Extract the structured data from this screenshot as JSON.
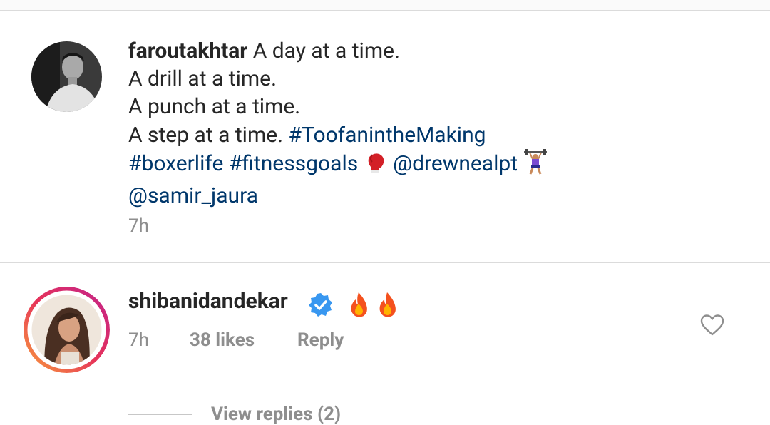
{
  "caption": {
    "username": "faroutakhtar",
    "line1_text": " A day at a time.",
    "line2_text": "A drill at a time.",
    "line3_text": "A punch at a time.",
    "line4_text": "A step at a time. ",
    "hashtag_toofan": "#ToofanintheMaking",
    "hashtag_boxerlife": "#boxerlife",
    "hashtag_fitnessgoals": "#fitnessgoals",
    "mention_drewnealpt": "@drewnealpt",
    "mention_samir": "@samir_jaura",
    "time": "7h"
  },
  "comment": {
    "username": "shibanidandekar",
    "time": "7h",
    "likes": "38 likes",
    "reply_label": "Reply",
    "view_replies": "View replies (2)"
  },
  "icons": {
    "verified": "verified-badge-icon",
    "fire": "fire-emoji",
    "boxing_glove": "boxing-glove-emoji",
    "weightlifter": "weightlifter-emoji",
    "heart": "heart-outline-icon"
  },
  "colors": {
    "link": "#00376b",
    "secondary_text": "#8e8e8e",
    "verified": "#3897f0"
  }
}
